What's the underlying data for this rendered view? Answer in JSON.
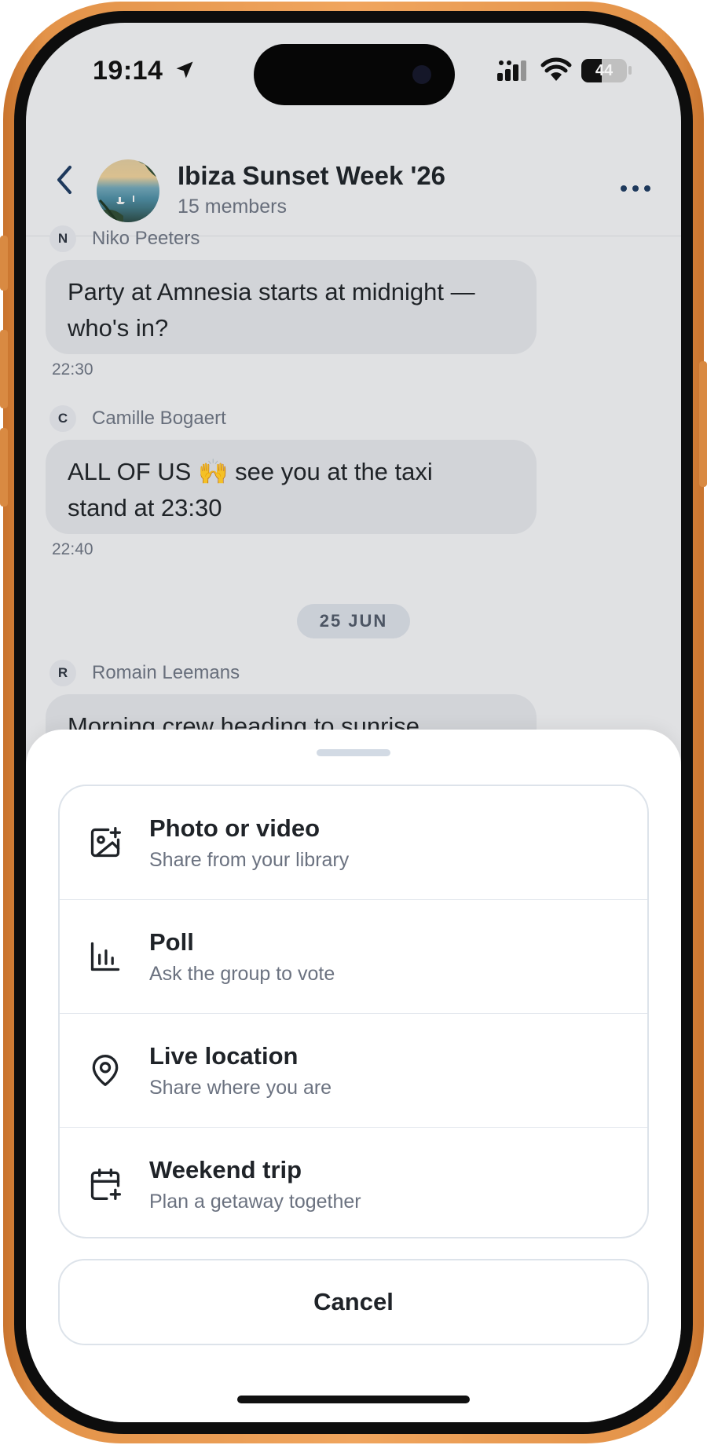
{
  "status_bar": {
    "time": "19:14",
    "battery": "44",
    "battery_level": 0.44
  },
  "header": {
    "title": "Ibiza Sunset Week '26",
    "subtitle": "15 members"
  },
  "messages": [
    {
      "initial": "N",
      "author": "Niko Peeters",
      "lines": [
        "Party at Amnesia starts at midnight —",
        "who's in?"
      ],
      "time": "22:30"
    },
    {
      "initial": "C",
      "author": "Camille Bogaert",
      "lines": [
        "ALL OF US 🙌 see you at the taxi",
        "stand at 23:30"
      ],
      "time": "22:40"
    },
    {
      "initial": "R",
      "author": "Romain Leemans",
      "lines": [
        "Morning crew heading to sunrise"
      ]
    }
  ],
  "date_separator": "25 JUN",
  "sheet": {
    "options": [
      {
        "title": "Photo or video",
        "subtitle": "Share from your library",
        "icon": "image-plus-icon"
      },
      {
        "title": "Poll",
        "subtitle": "Ask the group to vote",
        "icon": "bar-chart-icon"
      },
      {
        "title": "Live location",
        "subtitle": "Share where you are",
        "icon": "map-pin-icon"
      },
      {
        "title": "Weekend trip",
        "subtitle": "Plan a getaway together",
        "icon": "calendar-plus-icon"
      }
    ],
    "cancel_label": "Cancel"
  },
  "colors": {
    "frame": "#e39349",
    "screen_bg": "#eaebee",
    "bubble": "#dcdee2",
    "accent_text": "#1e3a5f"
  }
}
